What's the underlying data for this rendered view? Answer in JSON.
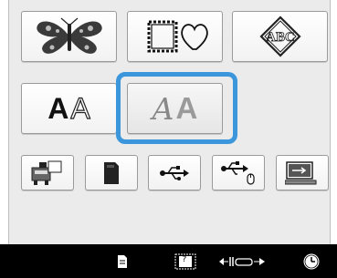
{
  "category_buttons": [
    {
      "name": "embroidery-patterns",
      "icon": "butterfly-icon"
    },
    {
      "name": "frame-patterns",
      "icon": "frame-heart-icon"
    },
    {
      "name": "monogramming",
      "icon": "monogram-abc-icon",
      "text": "ABC"
    }
  ],
  "font_buttons": [
    {
      "name": "character-font",
      "glyphs": [
        "A",
        "A"
      ],
      "icon": "letters-solid-outline-icon"
    },
    {
      "name": "decorative-alphabet",
      "glyphs": [
        "A",
        "A"
      ],
      "icon": "letters-decorative-icon",
      "selected": true
    }
  ],
  "source_buttons": [
    {
      "name": "machine-memory",
      "icon": "machine-icon"
    },
    {
      "name": "memory-card",
      "icon": "card-icon"
    },
    {
      "name": "usb-media",
      "icon": "usb-icon"
    },
    {
      "name": "usb-mouse-media",
      "icon": "usb-mouse-icon"
    },
    {
      "name": "computer",
      "icon": "computer-usb-icon"
    }
  ],
  "statusbar": {
    "page_icon": "page-icon",
    "frame_label": "?",
    "frame_icon": "frame-size-icon",
    "hoop_icon": "hoop-width-icon",
    "clock_icon": "clock-icon"
  },
  "colors": {
    "highlight": "#3c96dc",
    "screen": "#ebebeb",
    "statusbar": "#000000"
  }
}
